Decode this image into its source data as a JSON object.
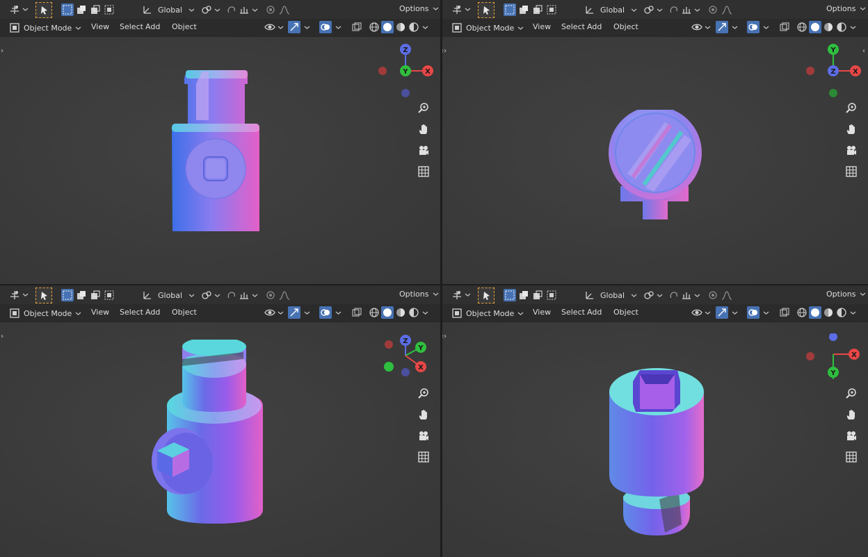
{
  "viewports": [
    {
      "id": "top-left",
      "header": {
        "orientation_label": "Global",
        "options_label": "Options",
        "mode_label": "Object Mode",
        "menus": [
          "View",
          "Select",
          "Add",
          "Object"
        ]
      },
      "gizmo": {
        "axes": [
          "Z",
          "Y",
          "X"
        ]
      }
    },
    {
      "id": "top-right",
      "header": {
        "orientation_label": "Global",
        "options_label": "Options",
        "mode_label": "Object Mode",
        "menus": [
          "View",
          "Select",
          "Add",
          "Object"
        ]
      },
      "gizmo": {
        "axes": [
          "Y",
          "Z",
          "X"
        ]
      }
    },
    {
      "id": "bottom-left",
      "header": {
        "orientation_label": "Global",
        "options_label": "Options",
        "mode_label": "Object Mode",
        "menus": [
          "View",
          "Select",
          "Add",
          "Object"
        ]
      },
      "gizmo": {
        "axes": [
          "Z",
          "Y",
          "X"
        ]
      }
    },
    {
      "id": "bottom-right",
      "header": {
        "orientation_label": "Global",
        "options_label": "Options",
        "mode_label": "Object Mode",
        "menus": [
          "View",
          "Select",
          "Add",
          "Object"
        ]
      },
      "gizmo": {
        "axes": [
          "X",
          "Y"
        ]
      }
    }
  ],
  "colors": {
    "axis_x": "#e84747",
    "axis_y": "#2fbf3f",
    "axis_z": "#5b6ee6",
    "active_blue": "#4772b3",
    "viewport_bg": "#3d3d3d"
  },
  "icons": [
    "transform-pivot-icon",
    "select-tool-icon",
    "select-box-icon",
    "select-extend-icon",
    "select-subtract-icon",
    "select-invert-icon",
    "orientation-icon",
    "snap-icon",
    "proportional-edit-icon",
    "overlay-eye-icon",
    "gizmo-icon",
    "overlays-icon",
    "xray-icon",
    "wireframe-shading-icon",
    "solid-shading-icon",
    "material-shading-icon",
    "rendered-shading-icon",
    "zoom-icon",
    "hand-pan-icon",
    "camera-icon",
    "grid-ortho-icon"
  ]
}
